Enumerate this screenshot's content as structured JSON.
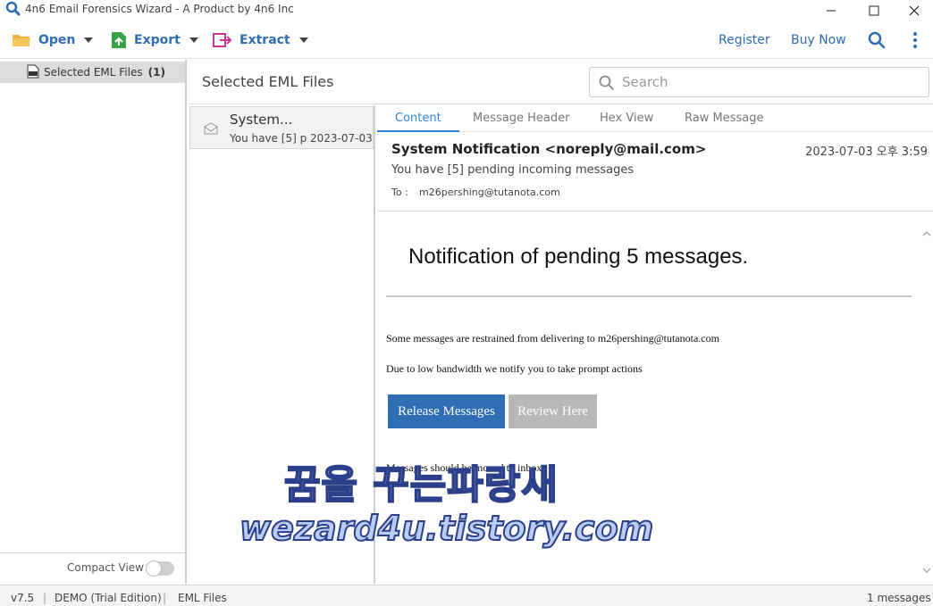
{
  "window": {
    "title": "4n6 Email Forensics Wizard - A Product by 4n6 Inc"
  },
  "toolbar": {
    "open_label": "Open",
    "export_label": "Export",
    "extract_label": "Extract",
    "register_label": "Register",
    "buynow_label": "Buy Now"
  },
  "sidebar": {
    "item_label": "Selected EML Files",
    "item_count": "(1)",
    "compact_label": "Compact View"
  },
  "list": {
    "heading": "Selected EML Files",
    "search_placeholder": "Search",
    "items": [
      {
        "subject": "System...",
        "snippet": "You have [5] p",
        "date": "2023-07-03"
      }
    ]
  },
  "preview": {
    "tabs": [
      {
        "label": "Content"
      },
      {
        "label": "Message Header"
      },
      {
        "label": "Hex View"
      },
      {
        "label": "Raw Message"
      }
    ],
    "from": "System Notification <noreply@mail.com>",
    "date": "2023-07-03 오후 3:59",
    "subject": "You have [5] pending incoming messages",
    "to_label": "To :",
    "to_value": "m26pershing@tutanota.com",
    "body": {
      "heading": "Notification of pending 5 messages.",
      "line1": "Some messages are restrained from delivering to m26pershing@tutanota.com",
      "line2": "Due to low bandwidth we notify you to take prompt actions",
      "release_button": "Release Messages",
      "review_button": "Review Here",
      "line3": "Messages should be moved to inbox."
    }
  },
  "watermark": {
    "line1": "꿈을 꾸는파랑새",
    "line2": "wezard4u.tistory.com"
  },
  "statusbar": {
    "version": "v7.5",
    "edition": "DEMO (Trial Edition)",
    "filetype": "EML Files",
    "message_count": "1 messages",
    "separator": "|"
  },
  "colors": {
    "accent": "#2f6db5",
    "tab_active": "#2f86d6"
  }
}
